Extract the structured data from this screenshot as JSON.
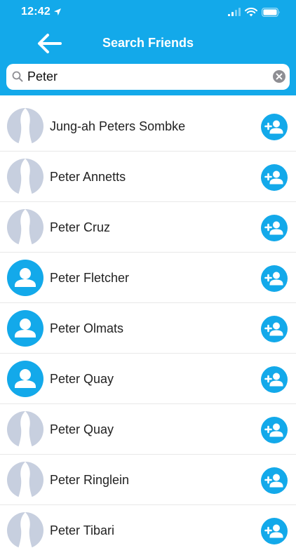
{
  "status_bar": {
    "time": "12:42",
    "icons": [
      "location-arrow-icon",
      "signal-icon",
      "wifi-icon",
      "battery-icon"
    ]
  },
  "header": {
    "title": "Search Friends",
    "back_icon": "arrow-left-icon",
    "background": "#13a9ea"
  },
  "search": {
    "value": "Peter",
    "icons": [
      "search-icon",
      "clear-icon"
    ]
  },
  "results": [
    {
      "name": "Jung-ah Peters Sombke",
      "avatar": "silhouette"
    },
    {
      "name": "Peter Annetts",
      "avatar": "silhouette"
    },
    {
      "name": "Peter Cruz",
      "avatar": "silhouette"
    },
    {
      "name": "Peter Fletcher",
      "avatar": "default-person"
    },
    {
      "name": "Peter Olmats",
      "avatar": "default-person"
    },
    {
      "name": "Peter Quay",
      "avatar": "default-person"
    },
    {
      "name": "Peter Quay",
      "avatar": "silhouette"
    },
    {
      "name": "Peter Ringlein",
      "avatar": "silhouette"
    },
    {
      "name": "Peter Tibari",
      "avatar": "silhouette"
    }
  ],
  "add_friend_icon": "add-person-icon",
  "colors": {
    "accent": "#13a9ea",
    "silhouette": "#c7cfdf",
    "divider": "#e8e8e8"
  }
}
